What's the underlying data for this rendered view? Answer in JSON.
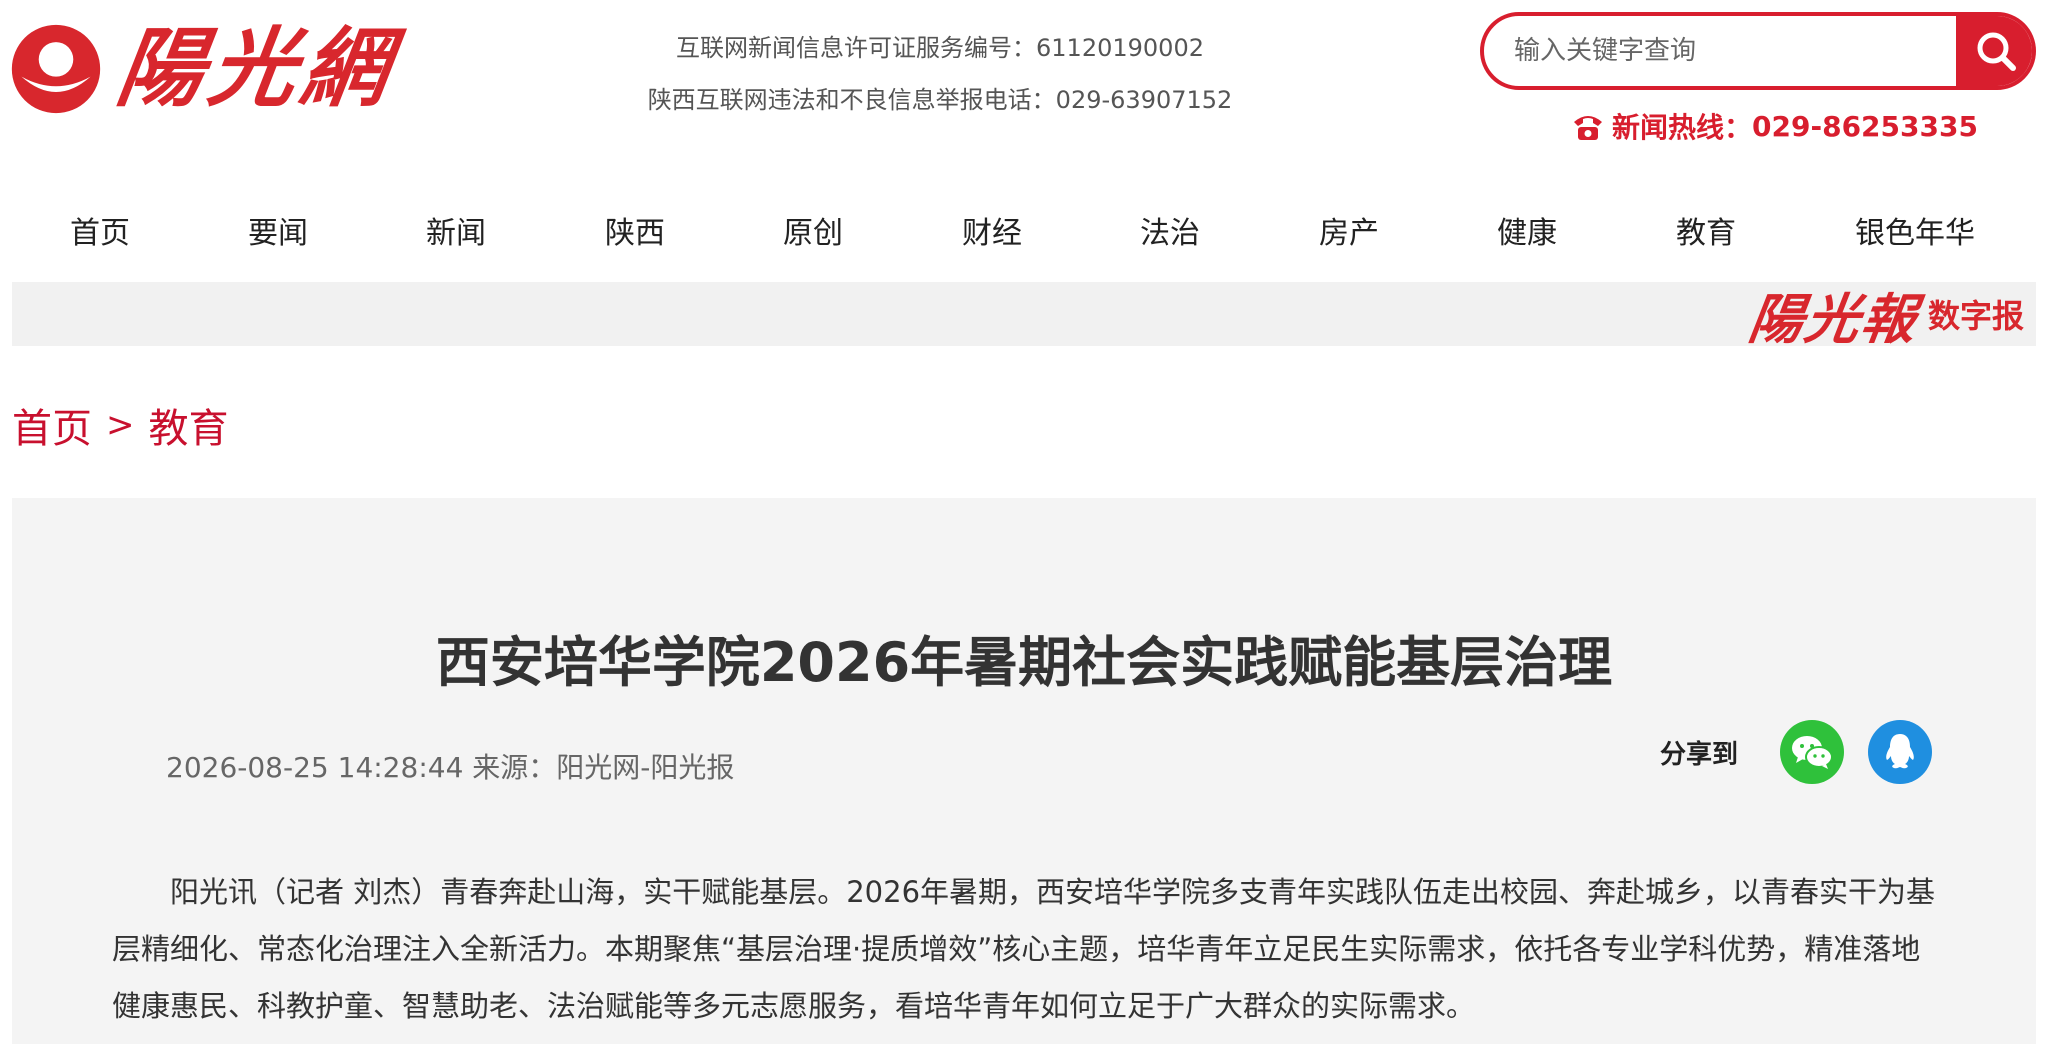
{
  "header": {
    "logo_text": "陽光網",
    "license_line1": "互联网新闻信息许可证服务编号：61120190002",
    "license_line2": "陕西互联网违法和不良信息举报电话：029-63907152",
    "search_placeholder": "输入关键字查询",
    "hotline_label": "新闻热线：",
    "hotline_number": "029-86253335"
  },
  "nav": {
    "items": [
      "首页",
      "要闻",
      "新闻",
      "陕西",
      "原创",
      "财经",
      "法治",
      "房产",
      "健康",
      "教育",
      "银色年华"
    ]
  },
  "digital": {
    "brand": "陽光報",
    "sub": "数字报"
  },
  "breadcrumb": {
    "home": "首页",
    "separator": ">",
    "current": "教育"
  },
  "article": {
    "title": "西安培华学院2026年暑期社会实践赋能基层治理",
    "meta": "2026-08-25 14:28:44 来源：阳光网-阳光报",
    "share_label": "分享到",
    "body": "阳光讯（记者 刘杰）青春奔赴山海，实干赋能基层。2026年暑期，西安培华学院多支青年实践队伍走出校园、奔赴城乡，以青春实干为基层精细化、常态化治理注入全新活力。本期聚焦“基层治理·提质增效”核心主题，培华青年立足民生实际需求，依托各专业学科优势，精准落地健康惠民、科教护童、智慧助老、法治赋能等多元志愿服务，看培华青年如何立足于广大群众的实际需求。"
  },
  "colors": {
    "brand_red": "#d81e2e",
    "wechat_green": "#2fc13b",
    "qq_blue": "#1f8fe0"
  }
}
